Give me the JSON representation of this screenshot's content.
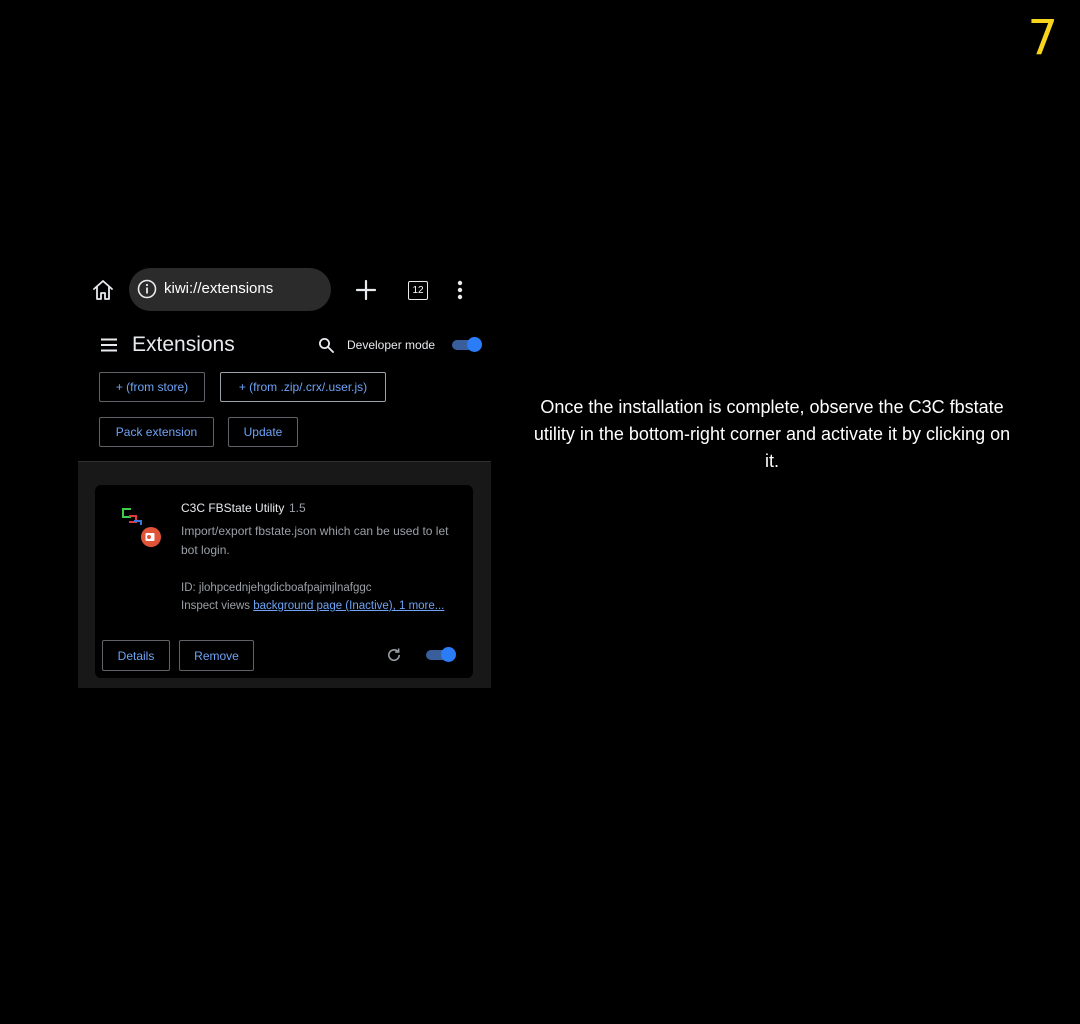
{
  "step_number": "7",
  "caption": "Once the installation is complete, observe the C3C fbstate utility in the bottom-right corner and activate it by clicking on it.",
  "browser": {
    "url": "kiwi://extensions",
    "tab_count": "12",
    "icons": {
      "home": "home-icon",
      "info": "info-icon",
      "new_tab": "plus-icon",
      "tabs": "tabs-icon",
      "menu": "more-vert-icon"
    }
  },
  "extensions_page": {
    "title": "Extensions",
    "developer_mode_label": "Developer mode",
    "developer_mode_on": true,
    "buttons": {
      "from_store": "+ (from store)",
      "from_zip": "+ (from .zip/.crx/.user.js)",
      "pack_extension": "Pack extension",
      "update": "Update"
    },
    "extension": {
      "name": "C3C FBState Utility",
      "version": "1.5",
      "description": "Import/export fbstate.json which can be used to let bot login.",
      "id_text": "ID: jlohpcednjehgdicboafpajmjlnafggc",
      "inspect_label": "Inspect views ",
      "inspect_link": "background page (Inactive), 1 more...",
      "details_label": "Details",
      "remove_label": "Remove",
      "enabled": true
    }
  },
  "colors": {
    "step_number": "#f7d51d",
    "accent": "#6ea3f5",
    "toggle_on": "#2a7cf7"
  }
}
